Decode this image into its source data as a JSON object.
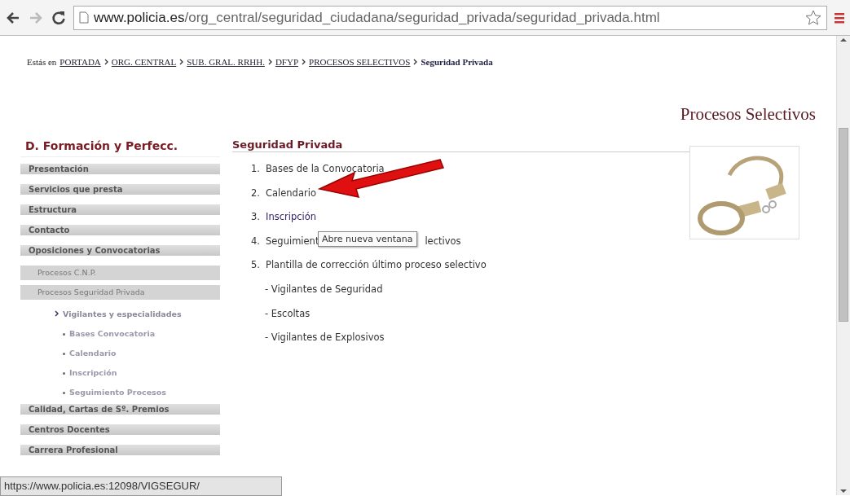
{
  "browser": {
    "url_host": "www.policia.es",
    "url_path": "/org_central/seguridad_ciudadana/seguridad_privada/seguridad_privada.html"
  },
  "breadcrumb": {
    "prefix": "Estás en",
    "links": [
      "PORTADA",
      "ORG. CENTRAL",
      "SUB. GRAL. RRHH.",
      "DFYP",
      "PROCESOS SELECTIVOS"
    ],
    "current": "Seguridad Privada"
  },
  "page_title": "Procesos Selectivos",
  "sidebar": {
    "title": "D. Formación y Perfecc.",
    "items": [
      {
        "label": "Presentación"
      },
      {
        "label": "Servicios que presta"
      },
      {
        "label": "Estructura"
      },
      {
        "label": "Contacto"
      },
      {
        "label": "Oposiciones y Convocatorias",
        "children": [
          {
            "label": "Procesos C.N.P."
          },
          {
            "label": "Procesos Seguridad Privada",
            "children": [
              {
                "label": "Vigilantes y especialidades",
                "children": [
                  {
                    "label": "Bases Convocatoria"
                  },
                  {
                    "label": "Calendario"
                  },
                  {
                    "label": "Inscripción"
                  },
                  {
                    "label": "Seguimiento Procesos"
                  }
                ]
              }
            ]
          }
        ]
      },
      {
        "label": "Calidad, Cartas de Sº. Premios"
      },
      {
        "label": "Centros Docentes"
      },
      {
        "label": "Carrera Profesional"
      }
    ]
  },
  "section": {
    "title": "Seguridad Privada",
    "items": [
      {
        "number": "1.",
        "text": "Bases de la Convocatoria",
        "hovered": false
      },
      {
        "number": "2.",
        "text": "Calendario",
        "hovered": false
      },
      {
        "number": "3.",
        "text": "Inscripción",
        "hovered": true
      },
      {
        "number": "4.",
        "text": "Seguimient",
        "text_after": "lectivos",
        "hovered": false
      },
      {
        "number": "5.",
        "text": "Plantilla de corrección último proceso selectivo",
        "hovered": false
      }
    ],
    "subitems": [
      "- Vigilantes de Seguridad",
      "- Escoltas",
      "- Vigilantes de Explosivos"
    ]
  },
  "tooltip": "Abre nueva ventana",
  "status_bar": "https://www.policia.es:12098/VIGSEGUR/"
}
